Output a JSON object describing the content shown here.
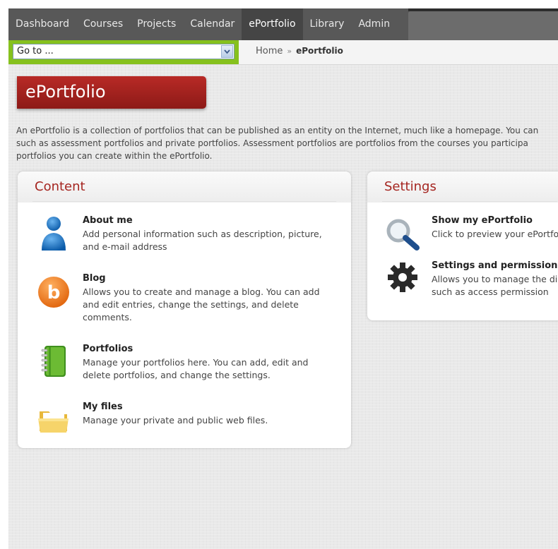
{
  "nav": {
    "items": [
      {
        "label": "Dashboard"
      },
      {
        "label": "Courses"
      },
      {
        "label": "Projects"
      },
      {
        "label": "Calendar"
      },
      {
        "label": "ePortfolio",
        "active": true
      },
      {
        "label": "Library"
      },
      {
        "label": "Admin"
      }
    ]
  },
  "goto": {
    "value": "Go to ..."
  },
  "breadcrumb": {
    "home": "Home",
    "separator": "»",
    "current": "ePortfolio"
  },
  "page": {
    "title": "ePortfolio",
    "intro_lines": [
      "An ePortfolio is a collection of portfolios that can be published as an entity on the Internet, much like a homepage. You can",
      "such as assessment portfolios and private portfolios. Assessment portfolios are portfolios from the courses you participa",
      "portfolios you can create within the ePortfolio."
    ]
  },
  "content_panel": {
    "title": "Content",
    "items": [
      {
        "icon": "person-icon",
        "title": "About me",
        "desc": [
          "Add personal information such as description, picture,",
          "and e-mail address"
        ]
      },
      {
        "icon": "blog-icon",
        "title": "Blog",
        "desc": [
          "Allows you to create and manage a blog. You can add",
          "and edit entries, change the settings, and delete",
          "comments."
        ]
      },
      {
        "icon": "notebook-icon",
        "title": "Portfolios",
        "desc": [
          "Manage your portfolios here. You can add, edit and",
          "delete portfolios, and change the settings."
        ]
      },
      {
        "icon": "folder-icon",
        "title": "My files",
        "desc": [
          "Manage your private and public web files."
        ]
      }
    ]
  },
  "settings_panel": {
    "title": "Settings",
    "items": [
      {
        "icon": "magnifier-icon",
        "title": "Show my ePortfolio",
        "desc": [
          "Click to preview your ePortfo"
        ]
      },
      {
        "icon": "gear-icon",
        "title": "Settings and permissions",
        "desc": [
          "Allows you to manage the di",
          "such as access permission"
        ]
      }
    ]
  },
  "colors": {
    "accent_red": "#a52520",
    "goto_green": "#86c11e",
    "nav_bg": "#585858"
  }
}
